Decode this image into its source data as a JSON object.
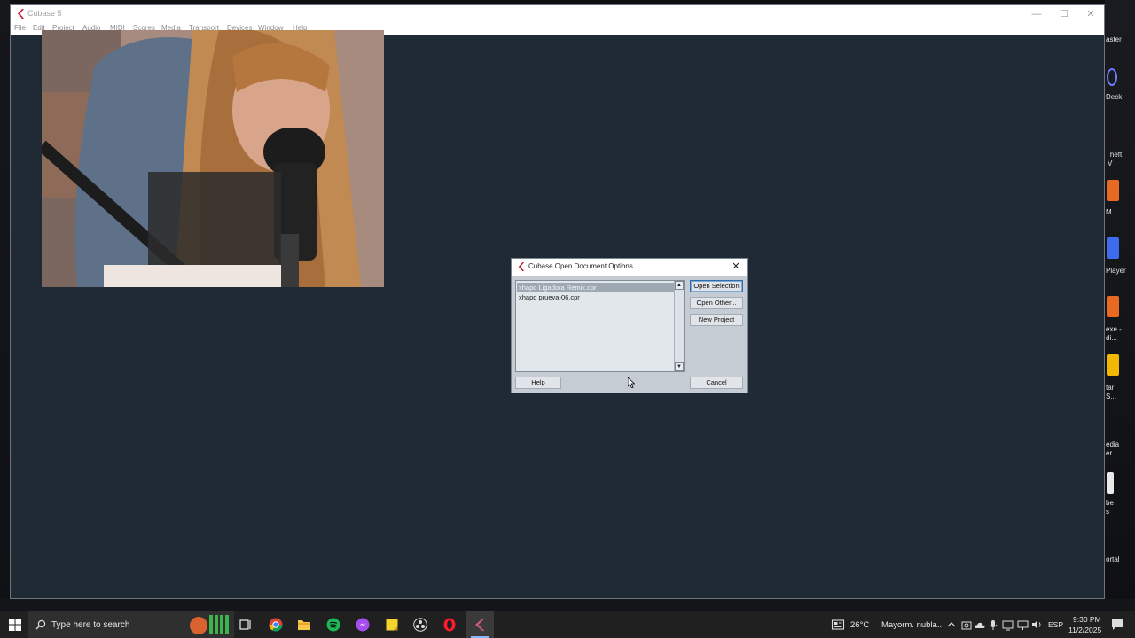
{
  "window": {
    "title": "Cubase 5",
    "controls": {
      "minimize": "—",
      "maximize": "☐",
      "close": "✕"
    },
    "menu": [
      "File",
      "Edit",
      "Project",
      "Audio",
      "MIDI",
      "Scores",
      "Media",
      "Transport",
      "Devices",
      "Window",
      "Help"
    ]
  },
  "dialog": {
    "title": "Cubase Open Document Options",
    "close_glyph": "✕",
    "files": [
      "xhapo Ligadora Remix.cpr",
      "xhapo prueva-06.cpr"
    ],
    "selected_index": 0,
    "buttons": {
      "open_selection": "Open Selection",
      "open_other": "Open Other...",
      "new_project": "New Project",
      "help": "Help",
      "cancel": "Cancel"
    }
  },
  "desktop_labels": [
    "aster",
    "Deck",
    "Theft",
    "V",
    "M",
    "Player",
    "exe -",
    "di...",
    "tar",
    "S...",
    "edia",
    "er",
    "be",
    "s",
    "ortal"
  ],
  "taskbar": {
    "search_placeholder": "Type here to search",
    "weather_temp": "26°C",
    "weather_text": "Mayorm. nubla...",
    "language": "ESP",
    "time": "9:30 PM",
    "date": "11/2/2025"
  },
  "colors": {
    "workspace": "#1f2a35",
    "dialog_bg": "#c5ccd3",
    "selection": "#9ea8b2",
    "default_button_border": "#2f6fb0",
    "cubase_logo": "#c0202a",
    "taskbar": "#202020"
  }
}
